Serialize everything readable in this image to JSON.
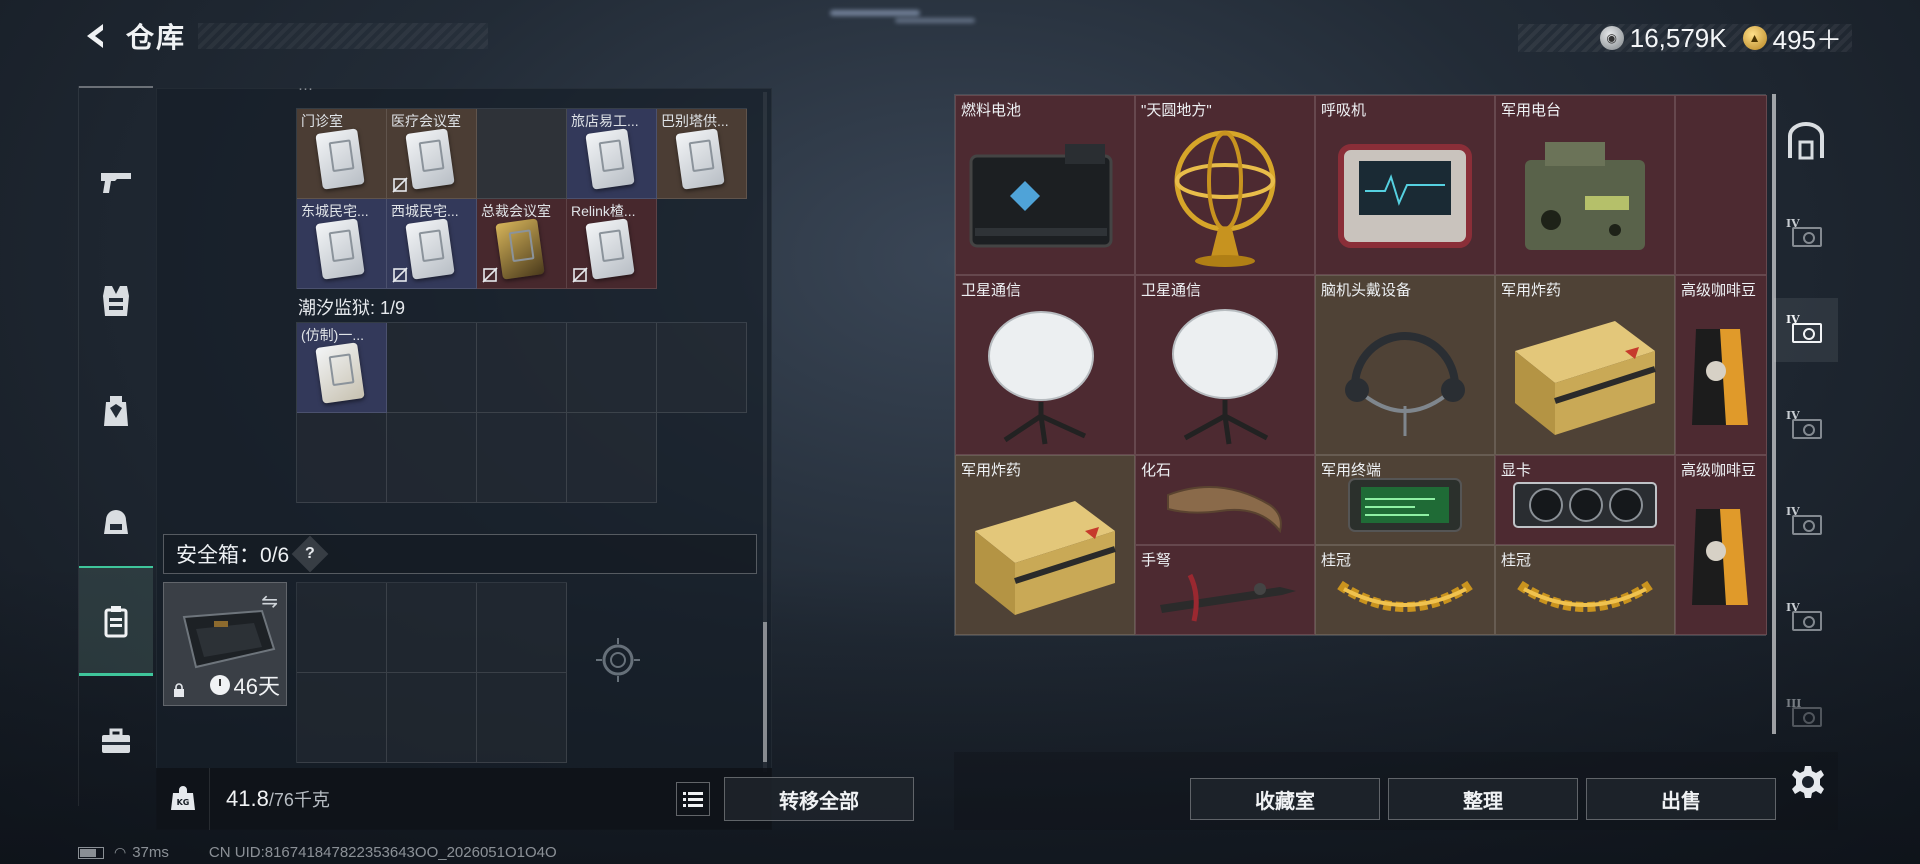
{
  "header": {
    "title": "仓库"
  },
  "currency": [
    {
      "icon": "silver-coin-icon",
      "value": "16,579K"
    },
    {
      "icon": "gold-coin-icon",
      "value": "495＋"
    }
  ],
  "left_nav": [
    {
      "icon": "gun-icon"
    },
    {
      "icon": "armor-vest-icon"
    },
    {
      "icon": "backpack-icon"
    },
    {
      "icon": "helmet-bag-icon"
    },
    {
      "icon": "safe-box-nav-icon",
      "active": true
    },
    {
      "icon": "toolbox-icon"
    }
  ],
  "keycards": [
    {
      "label": "门诊室",
      "color": "brown",
      "nolink": false
    },
    {
      "label": "医疗会议室",
      "color": "brown",
      "nolink": true
    },
    {
      "label": "",
      "color": "dark",
      "empty": true
    },
    {
      "label": "旅店易工...",
      "color": "blue",
      "nolink": false
    },
    {
      "label": "巴别塔供...",
      "color": "brown",
      "nolink": false
    },
    {
      "label": "东城民宅...",
      "color": "blue",
      "nolink": false
    },
    {
      "label": "西城民宅...",
      "color": "blue",
      "nolink": true
    },
    {
      "label": "总裁会议室",
      "color": "red",
      "nolink": true,
      "gold": true
    },
    {
      "label": "Relink楂...",
      "color": "red",
      "nolink": true
    }
  ],
  "tidal": {
    "title": "潮汐监狱: 1/9",
    "items": [
      {
        "label": "(仿制)一..."
      }
    ]
  },
  "safe_box": {
    "label": "安全箱：0/6",
    "help": "?",
    "days": "46天"
  },
  "weight": {
    "current": "41.8",
    "capacity": "/76千克"
  },
  "buttons": {
    "transfer_all": "转移全部",
    "collection": "收藏室",
    "organize": "整理",
    "sell": "出售"
  },
  "status": {
    "ping": "37ms",
    "uid": "CN UID:816741847822353643OO_2026051O1O4O"
  },
  "items": [
    {
      "name": "燃料电池",
      "color": "red"
    },
    {
      "name": "\"天圆地方\"",
      "color": "red"
    },
    {
      "name": "呼吸机",
      "color": "red"
    },
    {
      "name": "军用电台",
      "color": "red"
    },
    {
      "name": "卫星通信",
      "color": "red"
    },
    {
      "name": "卫星通信",
      "color": "red"
    },
    {
      "name": "脑机头戴设备",
      "color": "brown"
    },
    {
      "name": "军用炸药",
      "color": "brown"
    },
    {
      "name": "高级咖啡豆",
      "color": "red"
    },
    {
      "name": "军用炸药",
      "color": "brown"
    },
    {
      "name": "化石",
      "color": "red"
    },
    {
      "name": "军用终端",
      "color": "brown"
    },
    {
      "name": "显卡",
      "color": "red"
    },
    {
      "name": "高级咖啡豆",
      "color": "red"
    },
    {
      "name": "手弩",
      "color": "red"
    },
    {
      "name": "桂冠",
      "color": "brown"
    },
    {
      "name": "桂冠",
      "color": "brown"
    }
  ],
  "right_nav": [
    {
      "icon": "all-items-icon"
    },
    {
      "tier": "IV",
      "icon": "tier4-case-icon"
    },
    {
      "tier": "IV",
      "icon": "tier4-case-active-icon",
      "active": true
    },
    {
      "tier": "IV",
      "icon": "tier4-medical-icon"
    },
    {
      "tier": "IV",
      "icon": "tier4-case-icon"
    },
    {
      "tier": "IV",
      "icon": "tier4-case-icon"
    },
    {
      "tier": "III",
      "icon": "tier3-case-icon",
      "dim": true
    }
  ]
}
